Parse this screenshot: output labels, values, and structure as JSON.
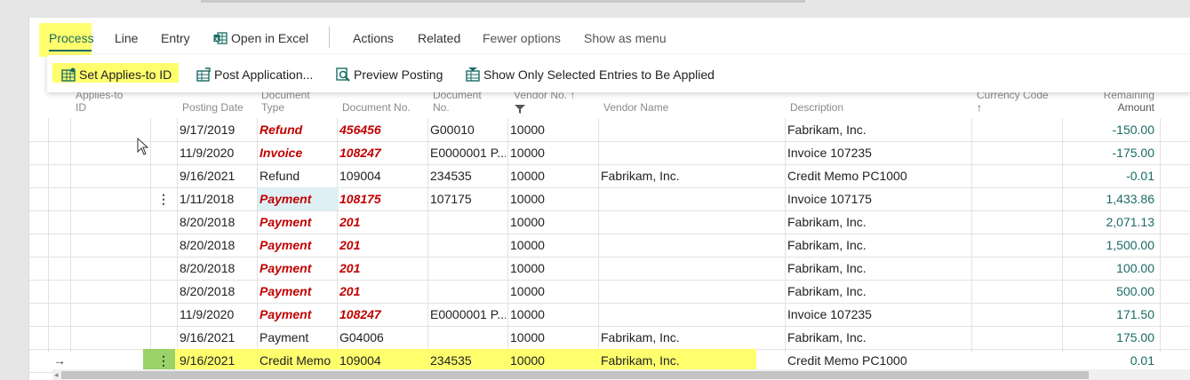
{
  "action_bar": {
    "process": "Process",
    "line": "Line",
    "entry": "Entry",
    "open_in_excel": "Open in Excel",
    "actions": "Actions",
    "related": "Related",
    "fewer_options": "Fewer options",
    "show_as_menu": "Show as menu"
  },
  "submenu": {
    "set_applies_to_id": "Set Applies-to ID",
    "post_application": "Post Application...",
    "preview_posting": "Preview Posting",
    "show_only_selected": "Show Only Selected Entries to Be Applied"
  },
  "columns": {
    "applies_to_id_1": "Applies-to",
    "applies_to_id_2": "ID",
    "posting_date": "Posting Date",
    "document_type_1": "Document",
    "document_type_2": "Type",
    "document_no": "Document No.",
    "ext_document_no_1": "Document",
    "ext_document_no_2": "No.",
    "vendor_no": "Vendor No. ↑",
    "vendor_name": "Vendor Name",
    "description": "Description",
    "currency_code": "Currency Code",
    "currency_sort_arrow": "↑",
    "remaining_amount_1": "Remaining",
    "remaining_amount_2": "Amount"
  },
  "rows": [
    {
      "posting_date": "9/17/2019",
      "doc_type": "Refund",
      "doc_no": "456456",
      "ext_doc_no": "G00010",
      "vendor_no": "10000",
      "vendor_name": "",
      "description": "Fabrikam, Inc.",
      "amount": "-150.00",
      "style": "bold"
    },
    {
      "posting_date": "11/9/2020",
      "doc_type": "Invoice",
      "doc_no": "108247",
      "ext_doc_no": "E0000001 P...",
      "vendor_no": "10000",
      "vendor_name": "",
      "description": "Invoice 107235",
      "amount": "-175.00",
      "style": "bold"
    },
    {
      "posting_date": "9/16/2021",
      "doc_type": "Refund",
      "doc_no": "109004",
      "ext_doc_no": "234535",
      "vendor_no": "10000",
      "vendor_name": "Fabrikam, Inc.",
      "description": "Credit Memo PC1000",
      "amount": "-0.01",
      "style": "normal"
    },
    {
      "posting_date": "1/11/2018",
      "doc_type": "Payment",
      "doc_no": "108175",
      "ext_doc_no": "107175",
      "vendor_no": "10000",
      "vendor_name": "",
      "description": "Invoice 107175",
      "amount": "1,433.86",
      "style": "bold"
    },
    {
      "posting_date": "8/20/2018",
      "doc_type": "Payment",
      "doc_no": "201",
      "ext_doc_no": "",
      "vendor_no": "10000",
      "vendor_name": "",
      "description": "Fabrikam, Inc.",
      "amount": "2,071.13",
      "style": "bold"
    },
    {
      "posting_date": "8/20/2018",
      "doc_type": "Payment",
      "doc_no": "201",
      "ext_doc_no": "",
      "vendor_no": "10000",
      "vendor_name": "",
      "description": "Fabrikam, Inc.",
      "amount": "1,500.00",
      "style": "bold"
    },
    {
      "posting_date": "8/20/2018",
      "doc_type": "Payment",
      "doc_no": "201",
      "ext_doc_no": "",
      "vendor_no": "10000",
      "vendor_name": "",
      "description": "Fabrikam, Inc.",
      "amount": "100.00",
      "style": "bold"
    },
    {
      "posting_date": "8/20/2018",
      "doc_type": "Payment",
      "doc_no": "201",
      "ext_doc_no": "",
      "vendor_no": "10000",
      "vendor_name": "",
      "description": "Fabrikam, Inc.",
      "amount": "500.00",
      "style": "bold"
    },
    {
      "posting_date": "11/9/2020",
      "doc_type": "Payment",
      "doc_no": "108247",
      "ext_doc_no": "E0000001 P...",
      "vendor_no": "10000",
      "vendor_name": "",
      "description": "Invoice 107235",
      "amount": "171.50",
      "style": "bold"
    },
    {
      "posting_date": "9/16/2021",
      "doc_type": "Payment",
      "doc_no": "G04006",
      "ext_doc_no": "",
      "vendor_no": "10000",
      "vendor_name": "Fabrikam, Inc.",
      "description": "Fabrikam, Inc.",
      "amount": "175.00",
      "style": "normal"
    },
    {
      "posting_date": "9/16/2021",
      "doc_type": "Credit Memo",
      "doc_no": "109004",
      "ext_doc_no": "234535",
      "vendor_no": "10000",
      "vendor_name": "Fabrikam, Inc.",
      "description": "Credit Memo PC1000",
      "amount": "0.01",
      "style": "normal"
    }
  ],
  "icons": {
    "row_menu": "⋮",
    "current_row_arrow": "→",
    "scroll_left": "◂"
  },
  "colors": {
    "highlight": "#ffff6e",
    "accent": "#1a6b64",
    "red_text": "#c00000",
    "selected_cell": "#dff0f5"
  }
}
